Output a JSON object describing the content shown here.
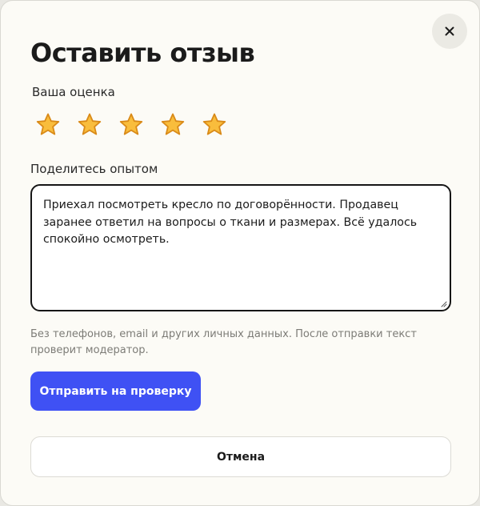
{
  "dialog": {
    "title": "Оставить отзыв",
    "close_icon": "close-icon"
  },
  "rating": {
    "label": "Ваша оценка",
    "value": 5,
    "max": 5,
    "star_icon": "star-icon",
    "star_fill_color": "#f9bd3c",
    "star_stroke_color": "#d98a18"
  },
  "experience": {
    "label": "Поделитесь опытом",
    "value": "Приехал посмотреть кресло по договорённости. Продавец заранее ответил на вопросы о ткани и размерах. Всё удалось спокойно осмотреть."
  },
  "hint": "Без телефонов, email и других личных данных. После отправки текст проверит модератор.",
  "actions": {
    "submit_label": "Отправить на проверку",
    "cancel_label": "Отмена"
  },
  "colors": {
    "accent": "#3f51f4",
    "background": "#fcfbf6"
  }
}
